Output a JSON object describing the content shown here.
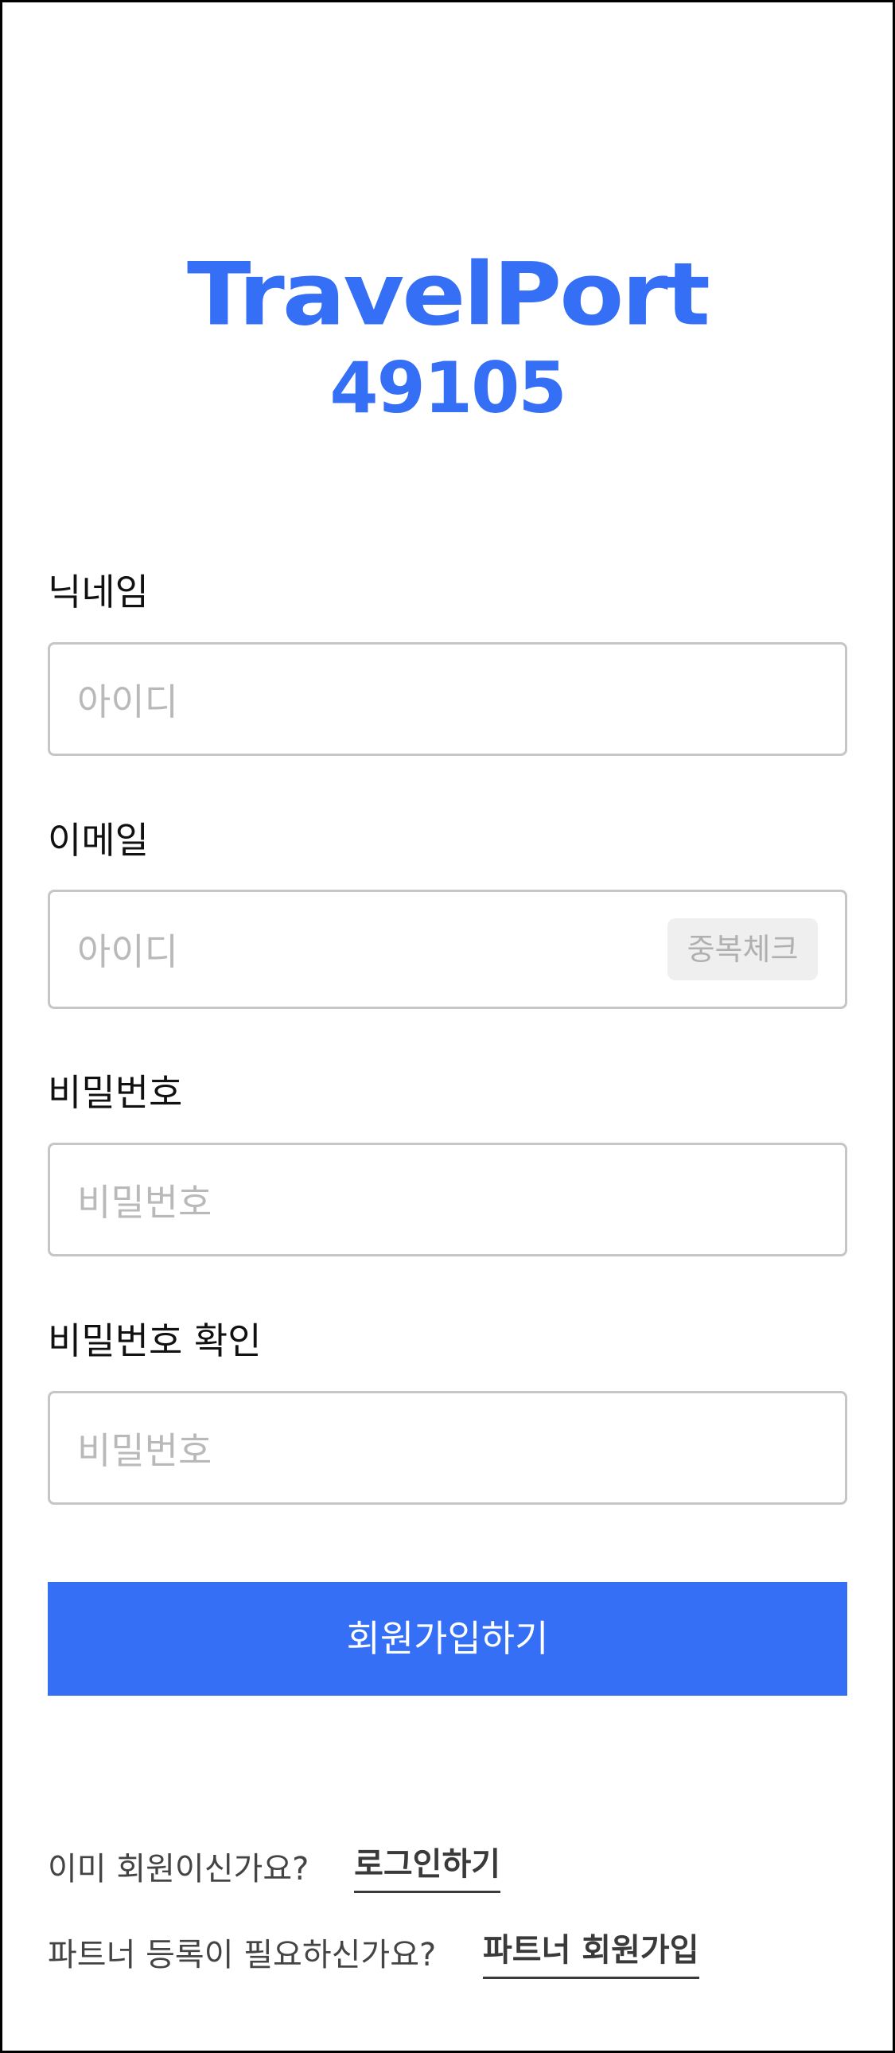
{
  "logo": {
    "title": "TravelPort",
    "code": "49105",
    "color": "#356ff6"
  },
  "form": {
    "nickname": {
      "label": "닉네임",
      "placeholder": "아이디"
    },
    "email": {
      "label": "이메일",
      "placeholder": "아이디",
      "check_button": "중복체크"
    },
    "password": {
      "label": "비밀번호",
      "placeholder": "비밀번호"
    },
    "password_confirm": {
      "label": "비밀번호 확인",
      "placeholder": "비밀번호"
    },
    "submit_label": "회원가입하기"
  },
  "footer": {
    "login_question": "이미 회원이신가요?",
    "login_link": "로그인하기",
    "partner_question": "파트너 등록이 필요하신가요?",
    "partner_link": "파트너 회원가입"
  },
  "colors": {
    "accent": "#356ff6",
    "field_border": "#c6c6c6",
    "placeholder": "#b9b9b9"
  }
}
